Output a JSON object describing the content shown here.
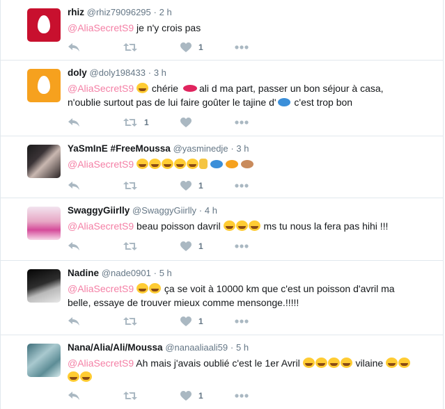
{
  "tweets": [
    {
      "name": "rhiz",
      "handle": "@rhiz79096295",
      "time": "2 h",
      "mention": "@AliaSecretS9",
      "text": " je n'y crois pas",
      "retweets": "",
      "likes": "1"
    },
    {
      "name": "doly",
      "handle": "@doly198433",
      "time": "3 h",
      "mention": "@AliaSecretS9",
      "text_a": " chérie ",
      "text_b": "ali d ma part, passer un bon séjour à casa, n'oublie surtout pas de lui faire goûter le tajine d'",
      "text_c": " c'est trop bon",
      "retweets": "1",
      "likes": ""
    },
    {
      "name": "YaSmInE #FreeMoussa",
      "handle": "@yasminedje",
      "time": "3 h",
      "mention": "@AliaSecretS9",
      "retweets": "",
      "likes": "1"
    },
    {
      "name": "SwaggyGiirlly",
      "handle": "@SwaggyGiirlly",
      "time": "4 h",
      "mention": "@AliaSecretS9",
      "text_a": " beau poisson davril ",
      "text_b": " ms tu nous la fera pas hihi !!!",
      "retweets": "",
      "likes": "1"
    },
    {
      "name": "Nadine",
      "handle": "@nade0901",
      "time": "5 h",
      "mention": "@AliaSecretS9",
      "text": " ça se voit à 10000 km que c'est un poisson d'avril ma belle, essaye de trouver mieux comme mensonge.!!!!!",
      "retweets": "",
      "likes": "1"
    },
    {
      "name": "Nana/Alia/Ali/Moussa",
      "handle": "@nanaaliaali59",
      "time": "5 h",
      "mention": "@AliaSecretS9",
      "text_a": " Ah mais j'avais oublié c'est le 1er Avril ",
      "text_b": " vilaine ",
      "retweets": "",
      "likes": "1"
    }
  ],
  "separator": "·",
  "icons": {
    "reply": "reply-icon",
    "retweet": "retweet-icon",
    "like": "heart-icon",
    "more": "more-icon"
  },
  "colors": {
    "mention": "#f47fa5",
    "action": "#aab8c2",
    "meta": "#657786"
  }
}
